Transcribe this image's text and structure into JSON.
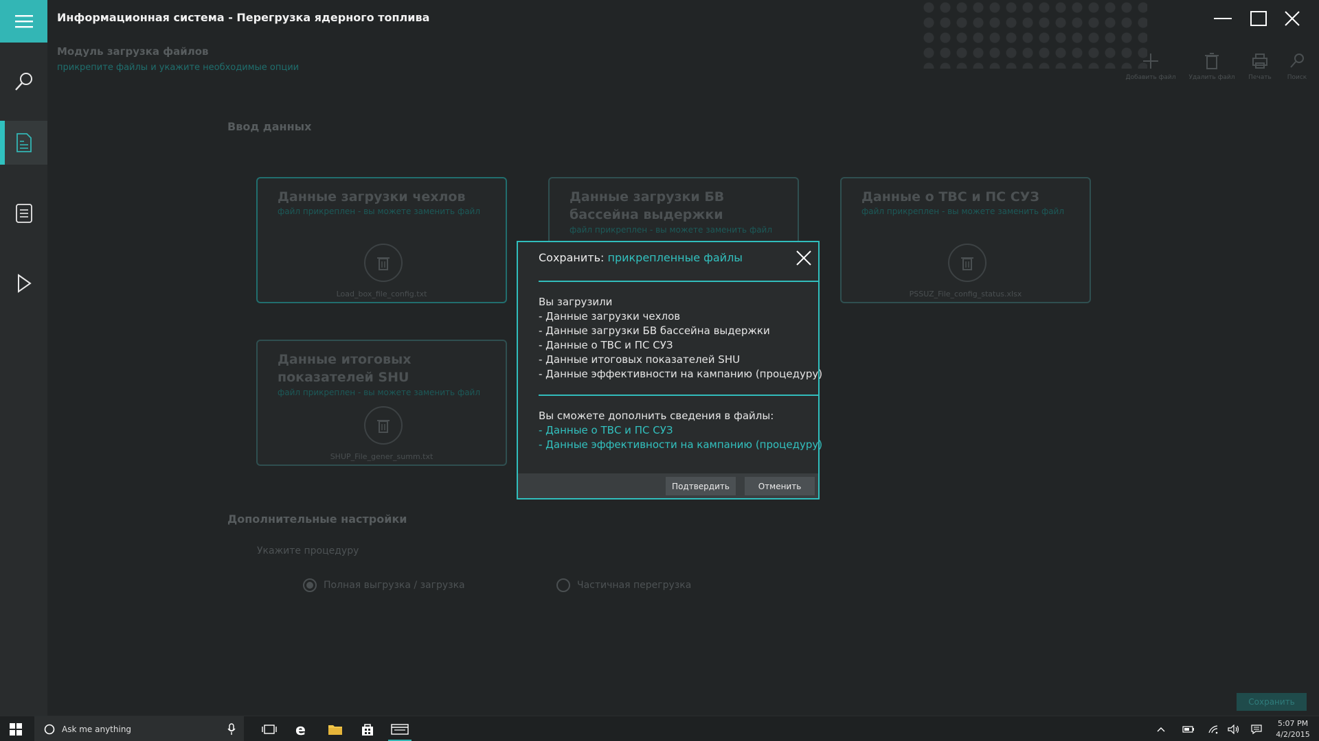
{
  "window": {
    "title": "Информационная система - Перегрузка ядерного топлива"
  },
  "module": {
    "title": "Модуль загрузка файлов",
    "subtitle": "прикрепите файлы и укажите необходимые опции"
  },
  "toolbar": {
    "add_label": "Добавить файл",
    "delete_label": "Удалить файл",
    "print_label": "Печать",
    "search_label": "Поиск"
  },
  "data_entry": {
    "section_title": "Ввод данных",
    "cards": [
      {
        "title": "Данные загрузки чехлов",
        "status": "файл прикреплен - вы можете заменить файл",
        "file": "Load_box_file_config.txt"
      },
      {
        "title": "Данные загрузки БВ бассейна выдержки",
        "status": "файл прикреплен - вы можете заменить файл",
        "file": ""
      },
      {
        "title": "Данные о ТВС и ПС СУЗ",
        "status": "файл прикреплен - вы можете заменить файл",
        "file": "PSSUZ_File_config_status.xlsx"
      },
      {
        "title": "Данные итоговых показателей SHU",
        "status": "файл прикреплен - вы можете заменить файл",
        "file": "SHUP_File_gener_summ.txt"
      }
    ]
  },
  "additional": {
    "section_title": "Дополнительные настройки",
    "procedure_label": "Укажите процедуру",
    "options": [
      {
        "label": "Полная выгрузка / загрузка",
        "selected": true
      },
      {
        "label": "Частичная  перегрузка",
        "selected": false
      }
    ]
  },
  "save_button": "Сохранить",
  "dialog": {
    "title_prefix": "Сохранить:",
    "title_highlight": "прикрепленные файлы",
    "uploaded_heading": "Вы загрузили",
    "uploaded_items": [
      "- Данные загрузки чехлов",
      "- Данные загрузки БВ бассейна выдержки",
      "- Данные о ТВС и ПС СУЗ",
      "- Данные итоговых показателей SHU",
      "- Данные эффективности на кампанию (процедуру)"
    ],
    "supplement_heading": "Вы сможете дополнить сведения в файлы:",
    "supplement_items": [
      "- Данные о ТВС и ПС СУЗ",
      "- Данные эффективности на кампанию (процедуру)"
    ],
    "confirm_label": "Подтвердить",
    "cancel_label": "Отменить"
  },
  "taskbar": {
    "search_placeholder": "Ask me anything",
    "time": "5:07 PM",
    "date": "4/2/2015"
  },
  "colors": {
    "accent": "#33b6b5",
    "background": "#222526",
    "dialog_border": "#30bebd"
  }
}
